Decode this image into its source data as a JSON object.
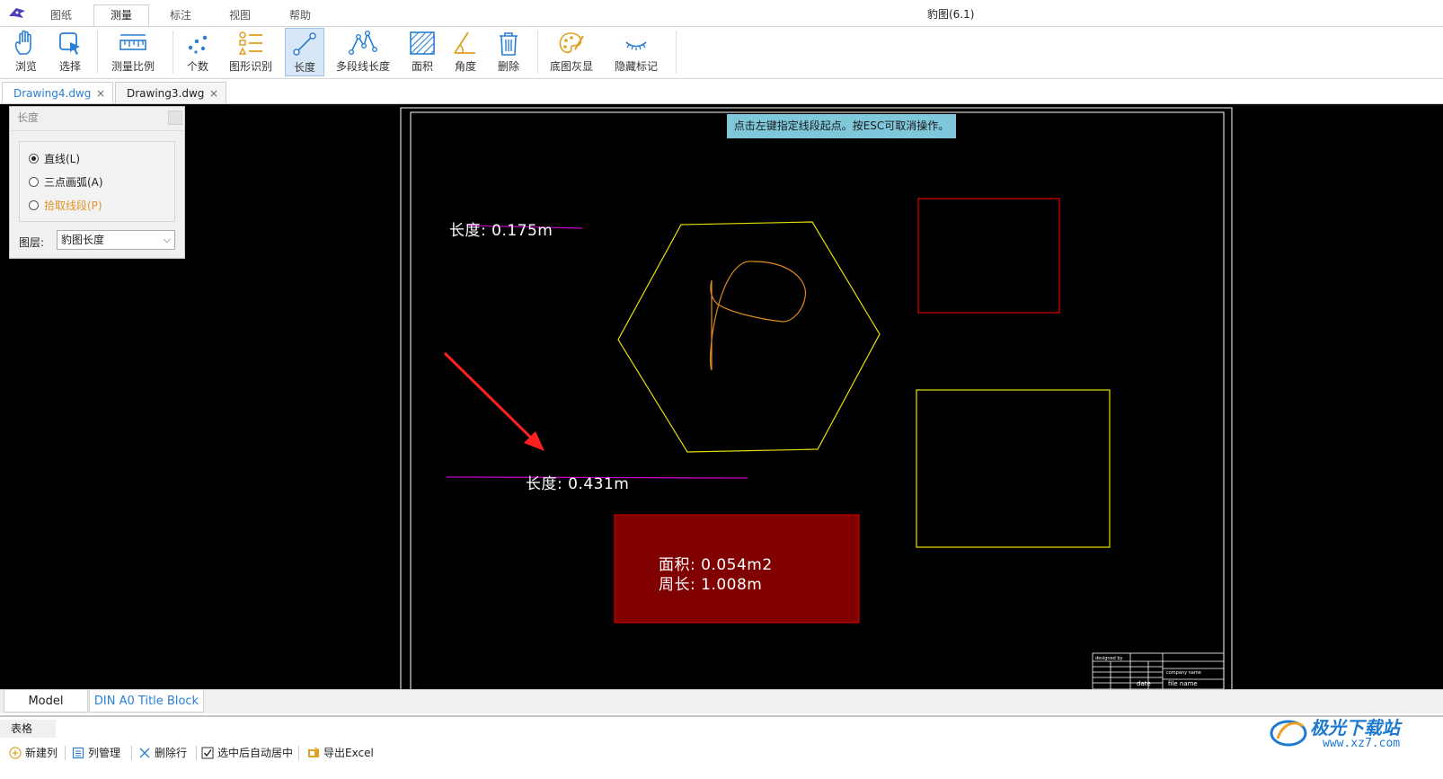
{
  "app": {
    "title": "豹图(6.1)"
  },
  "menu": {
    "tabs": [
      "图纸",
      "测量",
      "标注",
      "视图",
      "帮助"
    ],
    "active": "测量"
  },
  "ribbon": {
    "browse": "浏览",
    "select": "选择",
    "scale": "测量比例",
    "count": "个数",
    "shape_recognize": "图形识别",
    "length": "长度",
    "polyline_length": "多段线长度",
    "area": "面积",
    "angle": "角度",
    "delete": "删除",
    "base_gray": "底图灰显",
    "hide_marks": "隐藏标记"
  },
  "doc_tabs": [
    {
      "label": "Drawing4.dwg",
      "close": "×"
    },
    {
      "label": "Drawing3.dwg",
      "close": "×"
    }
  ],
  "length_panel": {
    "title": "长度",
    "options": [
      "直线(L)",
      "三点画弧(A)",
      "拾取线段(P)"
    ],
    "selected_option": "直线(L)",
    "layer_label": "图层:",
    "layer_value": "豹图长度"
  },
  "hint": "点击左键指定线段起点。按ESC可取消操作。",
  "measurements": {
    "len1": "长度: 0.175m",
    "len2": "长度: 0.431m",
    "area": "面积: 0.054m2",
    "perimeter": "周长: 1.008m"
  },
  "title_block": {
    "designed_by": "designed by",
    "company": "company name",
    "date": "date",
    "file": "file name"
  },
  "layout_tabs": {
    "model": "Model",
    "din": "DIN A0 Title Block"
  },
  "table_panel": {
    "label": "表格",
    "new_col": "新建列",
    "col_manage": "列管理",
    "delete_row": "删除行",
    "auto_center": "选中后自动居中",
    "export": "导出Excel"
  },
  "watermark": {
    "text": "极光下载站",
    "url": "www.xz7.com"
  },
  "colors": {
    "accent_blue": "#2a7fd4",
    "hint_bg": "#7fc7da",
    "yellow": "#e8e000",
    "red": "#e00000",
    "magenta": "#c000c0",
    "orange": "#e08a20",
    "dark_red_fill": "#800000"
  }
}
